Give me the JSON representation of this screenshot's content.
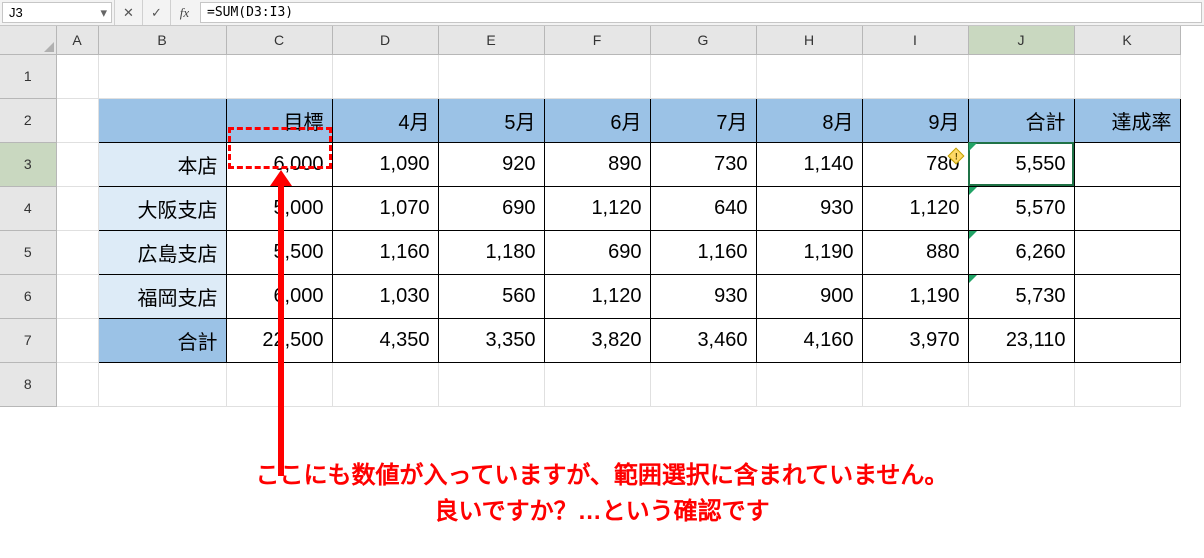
{
  "namebox": "J3",
  "formula": "=SUM(D3:I3)",
  "columns": [
    "A",
    "B",
    "C",
    "D",
    "E",
    "F",
    "G",
    "H",
    "I",
    "J",
    "K"
  ],
  "row_numbers": [
    "1",
    "2",
    "3",
    "4",
    "5",
    "6",
    "7",
    "8"
  ],
  "headers": {
    "B2": "",
    "C2": "目標",
    "D2": "4月",
    "E2": "5月",
    "F2": "6月",
    "G2": "7月",
    "H2": "8月",
    "I2": "9月",
    "J2": "合計",
    "K2": "達成率"
  },
  "row_labels": {
    "B3": "本店",
    "B4": "大阪支店",
    "B5": "広島支店",
    "B6": "福岡支店",
    "B7": "合計"
  },
  "values": {
    "C3": "6,000",
    "D3": "1,090",
    "E3": "920",
    "F3": "890",
    "G3": "730",
    "H3": "1,140",
    "I3": "780",
    "J3": "5,550",
    "C4": "5,000",
    "D4": "1,070",
    "E4": "690",
    "F4": "1,120",
    "G4": "640",
    "H4": "930",
    "I4": "1,120",
    "J4": "5,570",
    "C5": "5,500",
    "D5": "1,160",
    "E5": "1,180",
    "F5": "690",
    "G5": "1,160",
    "H5": "1,190",
    "I5": "880",
    "J5": "6,260",
    "C6": "6,000",
    "D6": "1,030",
    "E6": "560",
    "F6": "1,120",
    "G6": "930",
    "H6": "900",
    "I6": "1,190",
    "J6": "5,730",
    "C7": "22,500",
    "D7": "4,350",
    "E7": "3,350",
    "F7": "3,820",
    "G7": "3,460",
    "H7": "4,160",
    "I7": "3,970",
    "J7": "23,110"
  },
  "annotation": {
    "line1": "ここにも数値が入っていますが、範囲選択に含まれていません。",
    "line2": "良いですか？…という確認です"
  }
}
